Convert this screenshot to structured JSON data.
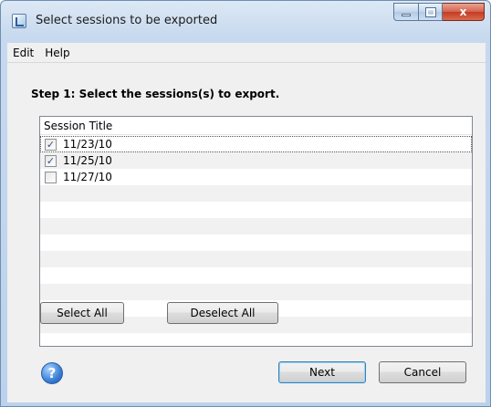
{
  "window": {
    "title": "Select sessions to be exported"
  },
  "menu": {
    "items": [
      "Edit",
      "Help"
    ]
  },
  "step_label": "Step 1: Select the sessions(s) to export.",
  "list": {
    "header": "Session Title",
    "rows": [
      {
        "label": "11/23/10",
        "checked": true
      },
      {
        "label": "11/25/10",
        "checked": true
      },
      {
        "label": "11/27/10",
        "checked": false
      }
    ]
  },
  "buttons": {
    "select_all": "Select All",
    "deselect_all": "Deselect All",
    "next": "Next",
    "cancel": "Cancel"
  },
  "icons": {
    "app": "app-icon",
    "help": "help-icon",
    "minimize": "minimize-icon",
    "maximize": "maximize-icon",
    "close": "close-icon"
  },
  "caption": {
    "close_glyph": "x"
  },
  "help_glyph": "?",
  "checkmark": "✓"
}
